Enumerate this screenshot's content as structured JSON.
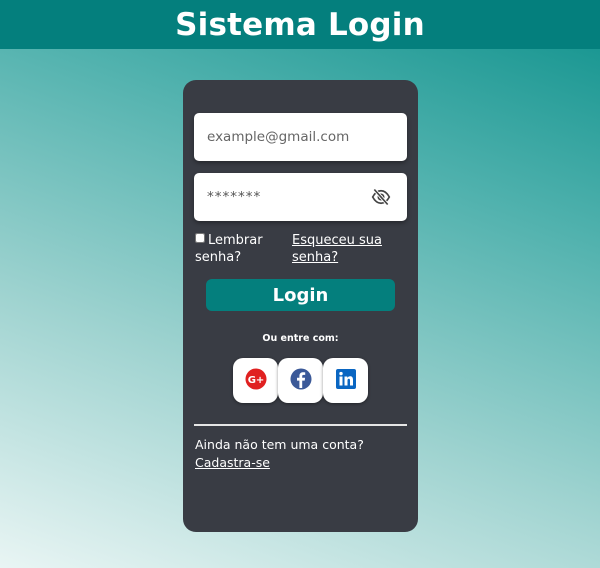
{
  "header": {
    "title": "Sistema Login"
  },
  "form": {
    "email_placeholder": "example@gmail.com",
    "password_placeholder": "*******",
    "remember_label": "Lembrar senha?",
    "forgot_link": "Esqueceu sua senha?",
    "login_button": "Login",
    "or_text": "Ou entre com:",
    "signup_text": "Ainda não tem uma conta?",
    "signup_link": "Cadastra-se"
  },
  "socials": [
    {
      "name": "google-plus-icon",
      "color": "#e02020"
    },
    {
      "name": "facebook-icon",
      "color": "#3b5998"
    },
    {
      "name": "linkedin-icon",
      "color": "#0a66c2"
    }
  ],
  "colors": {
    "header": "#047f7d",
    "card": "#393c44",
    "button": "#047f7d"
  }
}
